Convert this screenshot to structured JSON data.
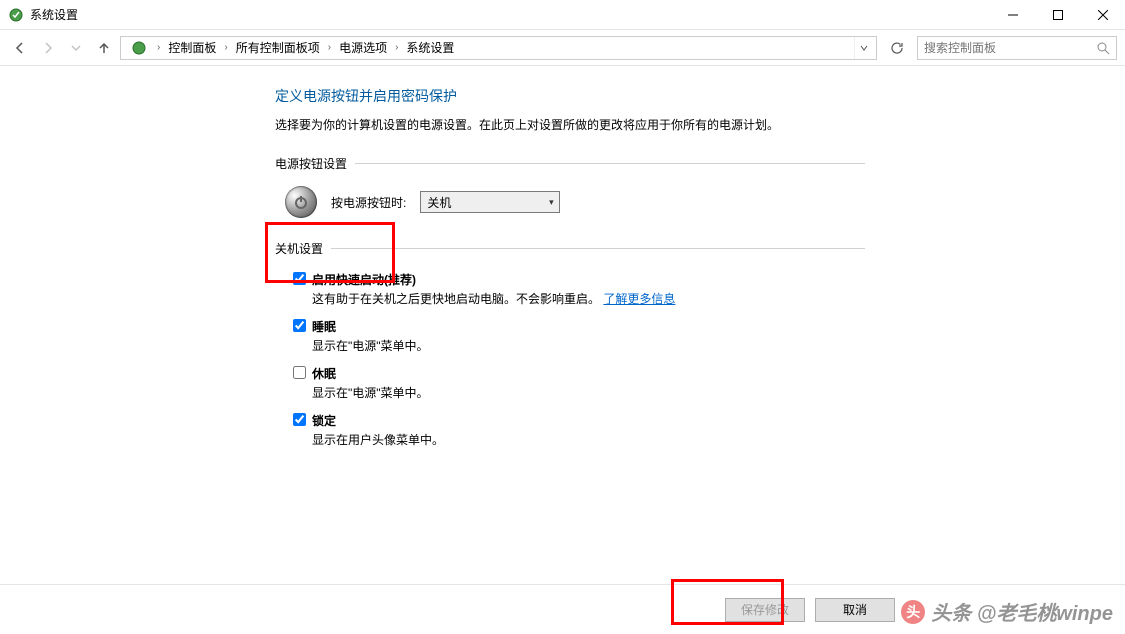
{
  "window": {
    "title": "系统设置"
  },
  "breadcrumb": {
    "items": [
      "控制面板",
      "所有控制面板项",
      "电源选项",
      "系统设置"
    ]
  },
  "search": {
    "placeholder": "搜索控制面板"
  },
  "page": {
    "title": "定义电源按钮并启用密码保护",
    "desc": "选择要为你的计算机设置的电源设置。在此页上对设置所做的更改将应用于你所有的电源计划。"
  },
  "powerButton": {
    "sectionLabel": "电源按钮设置",
    "label": "按电源按钮时:",
    "value": "关机"
  },
  "shutdown": {
    "sectionLabel": "关机设置",
    "items": [
      {
        "checked": true,
        "label": "启用快速启动(推荐)",
        "desc": "这有助于在关机之后更快地启动电脑。不会影响重启。",
        "link": "了解更多信息"
      },
      {
        "checked": true,
        "label": "睡眠",
        "desc": "显示在\"电源\"菜单中。"
      },
      {
        "checked": false,
        "label": "休眠",
        "desc": "显示在\"电源\"菜单中。"
      },
      {
        "checked": true,
        "label": "锁定",
        "desc": "显示在用户头像菜单中。"
      }
    ]
  },
  "footer": {
    "save": "保存修改",
    "cancel": "取消"
  },
  "watermark": {
    "text": "头条 @老毛桃winpe"
  }
}
